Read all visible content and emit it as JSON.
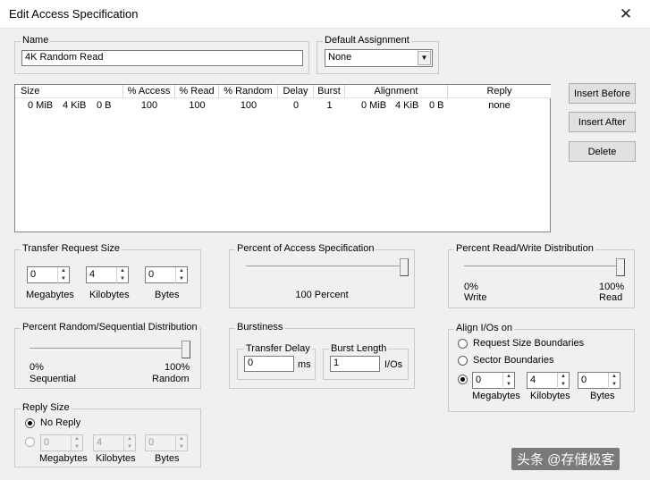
{
  "window": {
    "title": "Edit Access Specification",
    "close_glyph": "✕"
  },
  "name_group": {
    "label": "Name",
    "value": "4K Random Read"
  },
  "default_assignment": {
    "label": "Default Assignment",
    "value": "None"
  },
  "spec_table": {
    "columns": [
      "Size",
      "% Access",
      "% Read",
      "% Random",
      "Delay",
      "Burst",
      "Alignment",
      "Reply"
    ],
    "rows": [
      {
        "size_mib": "0 MiB",
        "size_kib": "4 KiB",
        "size_b": "0 B",
        "access": "100",
        "read": "100",
        "random": "100",
        "delay": "0",
        "burst": "1",
        "align_mib": "0 MiB",
        "align_kib": "4 KiB",
        "align_b": "0 B",
        "reply": "none"
      }
    ]
  },
  "buttons": {
    "insert_before": "Insert Before",
    "insert_after": "Insert After",
    "delete": "Delete"
  },
  "transfer_size": {
    "label": "Transfer Request Size",
    "megabytes": {
      "value": "0",
      "label": "Megabytes"
    },
    "kilobytes": {
      "value": "4",
      "label": "Kilobytes"
    },
    "bytes": {
      "value": "0",
      "label": "Bytes"
    }
  },
  "percent_access": {
    "label": "Percent of Access Specification",
    "value_text": "100 Percent",
    "value": 100
  },
  "read_write": {
    "label": "Percent Read/Write Distribution",
    "value": 100,
    "left_pct": "0%",
    "left_label": "Write",
    "right_pct": "100%",
    "right_label": "Read"
  },
  "random_seq": {
    "label": "Percent Random/Sequential Distribution",
    "value": 100,
    "left_pct": "0%",
    "left_label": "Sequential",
    "right_pct": "100%",
    "right_label": "Random"
  },
  "burstiness": {
    "label": "Burstiness",
    "transfer_delay": {
      "label": "Transfer Delay",
      "value": "0",
      "unit": "ms"
    },
    "burst_length": {
      "label": "Burst Length",
      "value": "1",
      "unit": "I/Os"
    }
  },
  "align": {
    "label": "Align I/Os on",
    "opt_request": "Request Size Boundaries",
    "opt_sector": "Sector Boundaries",
    "megabytes": {
      "value": "0",
      "label": "Megabytes"
    },
    "kilobytes": {
      "value": "4",
      "label": "Kilobytes"
    },
    "bytes": {
      "value": "0",
      "label": "Bytes"
    }
  },
  "reply_size": {
    "label": "Reply Size",
    "no_reply": "No Reply",
    "megabytes": {
      "value": "0",
      "label": "Megabytes"
    },
    "kilobytes": {
      "value": "4",
      "label": "Kilobytes"
    },
    "bytes": {
      "value": "0",
      "label": "Bytes"
    }
  },
  "watermark": "头条 @存储极客"
}
